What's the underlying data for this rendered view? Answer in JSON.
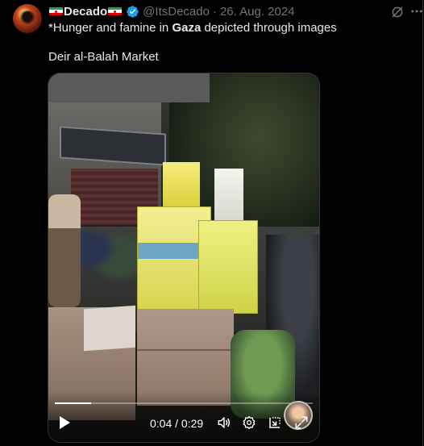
{
  "tweet": {
    "author_name": "Decado",
    "author_handle": "@ItsDecado",
    "separator": "·",
    "date": "26. Aug. 2024",
    "text_line1_before": "*Hunger and famine in ",
    "text_line1_bold": "Gaza",
    "text_line1_after": " depicted through images",
    "text_line2": "Deir al-Balah Market"
  },
  "icons": {
    "flag": "iran-flag-icon",
    "verified": "verified-badge-icon",
    "grok": "grok-icon",
    "more": "more-icon"
  },
  "video": {
    "current_time": "0:04",
    "duration": "0:29",
    "time_display": "0:04 / 0:29",
    "progress_fraction": 0.14
  },
  "colors": {
    "background": "#000000",
    "text": "#e7e9ea",
    "secondary_text": "#71767b",
    "verified_blue": "#1d9bf0",
    "border": "#2f3336"
  }
}
